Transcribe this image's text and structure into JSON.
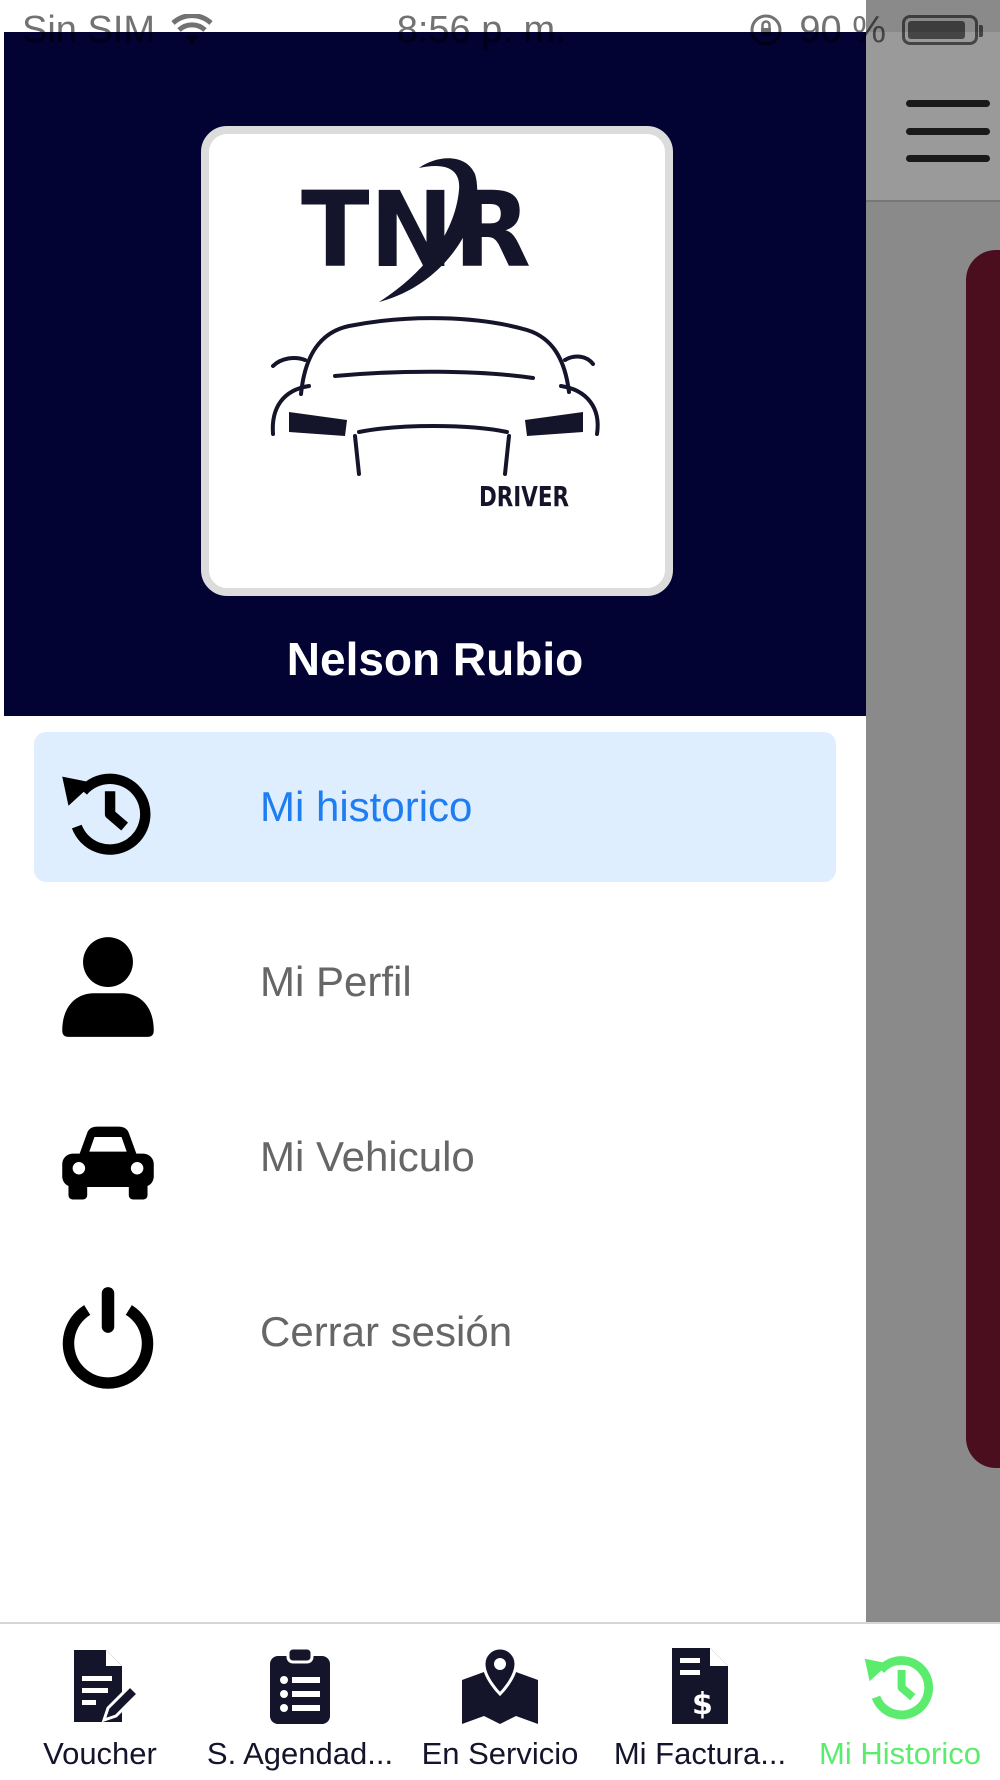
{
  "status_bar": {
    "carrier": "Sin SIM",
    "time": "8:56 p. m.",
    "battery": "90 %",
    "battery_level": 0.9,
    "icons": [
      "wifi-icon",
      "orientation-lock-icon",
      "battery-icon"
    ]
  },
  "background_app": {
    "menu_icon": "hamburger-icon",
    "card_color": "#4a0e1e"
  },
  "drawer": {
    "header_color": "#020233",
    "logo": {
      "brand": "TNR",
      "sub": "DRIVER"
    },
    "user_name": "Nelson Rubio",
    "items": [
      {
        "label": "Mi historico",
        "icon": "history-icon",
        "active": true
      },
      {
        "label": "Mi Perfil",
        "icon": "user-icon",
        "active": false
      },
      {
        "label": "Mi Vehiculo",
        "icon": "car-icon",
        "active": false
      },
      {
        "label": "Cerrar sesión",
        "icon": "power-icon",
        "active": false
      }
    ]
  },
  "tab_bar": {
    "active_color": "#5bec6e",
    "tabs": [
      {
        "label": "Voucher",
        "icon": "document-edit-icon"
      },
      {
        "label": "S. Agendad...",
        "icon": "clipboard-list-icon"
      },
      {
        "label": "En Servicio",
        "icon": "map-marker-icon"
      },
      {
        "label": "Mi Factura...",
        "icon": "invoice-dollar-icon"
      },
      {
        "label": "Mi Historico",
        "icon": "history-icon",
        "active": true
      }
    ]
  }
}
